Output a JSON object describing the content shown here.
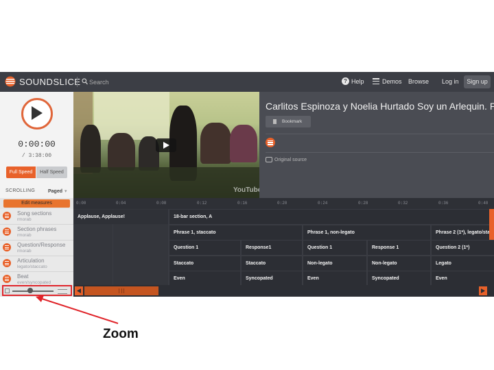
{
  "header": {
    "brand": "SOUNDSLICE",
    "search_placeholder": "Search",
    "nav": {
      "help": "Help",
      "demos": "Demos",
      "browse": "Browse",
      "login": "Log in",
      "signup": "Sign up"
    }
  },
  "player": {
    "current_time": "0:00:00",
    "duration": "/ 3:38:00",
    "full_speed": "Full Speed",
    "half_speed": "Half Speed",
    "scrolling_label": "SCROLLING",
    "scrolling_mode": "Paged"
  },
  "video": {
    "logo_text": "YouTube"
  },
  "info": {
    "title": "Carlitos Espinoza y Noelia Hurtado Soy un Arlequin. P",
    "bookmark_label": "Bookmark",
    "original_source": "Original source"
  },
  "timeline": {
    "edit_button": "Edit measures",
    "ticks": [
      "0:00",
      "0:04",
      "0:08",
      "0:12",
      "0:16",
      "0:20",
      "0:24",
      "0:28",
      "0:32",
      "0:36",
      "0:40"
    ]
  },
  "tracks": [
    {
      "name": "Song sections",
      "user": "rmorab"
    },
    {
      "name": "Section phrases",
      "user": "rmorab"
    },
    {
      "name": "Question/Response",
      "user": "rmorab"
    },
    {
      "name": "Articulation",
      "user": "legato/staccato"
    },
    {
      "name": "Beat",
      "user": "even/syncopated"
    }
  ],
  "grid": {
    "row1": [
      "Applause, Applause!",
      "18-bar section, A"
    ],
    "row2": [
      "Phrase 1, staccato",
      "Phrase 1, non-legato",
      "Phrase 2 (1*), legato/sta"
    ],
    "row3": [
      "Question 1",
      "Response1",
      "Question 1",
      "Response 1",
      "Question 2 (1*)"
    ],
    "row4": [
      "Staccato",
      "Staccato",
      "Non-legato",
      "Non-legato",
      "Legato"
    ],
    "row5": [
      "Even",
      "Syncopated",
      "Even",
      "Syncopated",
      "Even"
    ]
  },
  "annotation": {
    "label": "Zoom"
  },
  "colors": {
    "accent": "#e8612a",
    "annotation_red": "#e0242a",
    "dark_bg": "#3b3d44"
  }
}
